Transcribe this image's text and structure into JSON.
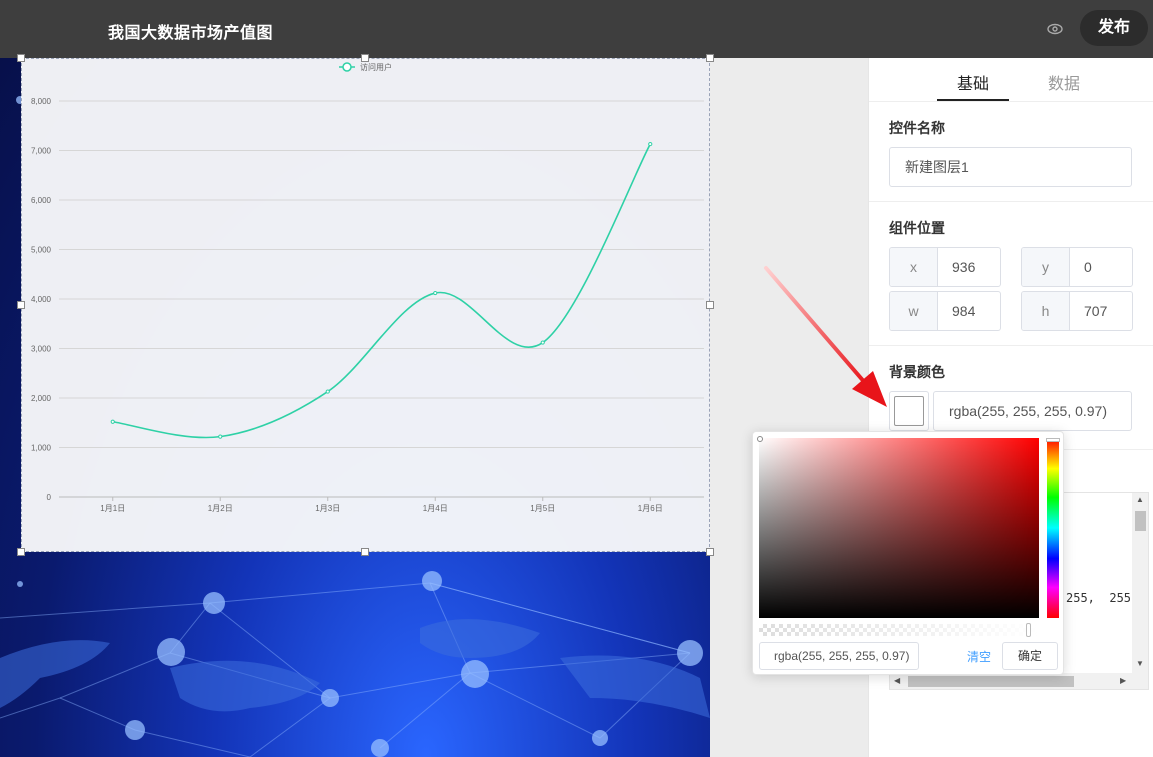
{
  "header": {
    "title": "我国大数据市场产值图",
    "publish_label": "发布"
  },
  "tabs": [
    {
      "label": "基础",
      "active": true
    },
    {
      "label": "数据",
      "active": false
    }
  ],
  "panel": {
    "name_section": {
      "title": "控件名称",
      "value": "新建图层1"
    },
    "position_section": {
      "title": "组件位置",
      "fields": [
        {
          "label": "x",
          "value": "936"
        },
        {
          "label": "y",
          "value": "0"
        },
        {
          "label": "w",
          "value": "984"
        },
        {
          "label": "h",
          "value": "707"
        }
      ]
    },
    "bg_section": {
      "title": "背景颜色",
      "value": "rgba(255, 255, 255, 0.97)"
    },
    "code_snippet": "255,  255,"
  },
  "color_picker": {
    "input_value": "rgba(255, 255, 255, 0.97)",
    "clear_label": "清空",
    "confirm_label": "确定",
    "alpha": 0.97
  },
  "chart_data": {
    "type": "line",
    "legend": [
      "访问用户"
    ],
    "legend_position": "top-center",
    "categories": [
      "1月1日",
      "1月2日",
      "1月3日",
      "1月4日",
      "1月5日",
      "1月6日"
    ],
    "series": [
      {
        "name": "访问用户",
        "values": [
          1520,
          1220,
          2130,
          4120,
          3120,
          7130
        ],
        "color": "#2ed1a6"
      }
    ],
    "ylim": [
      0,
      8000
    ],
    "yticks": [
      "0",
      "1,000",
      "2,000",
      "3,000",
      "4,000",
      "5,000",
      "6,000",
      "7,000",
      "8,000"
    ],
    "grid": true,
    "smooth": true
  },
  "colors": {
    "topbar": "#3e3e3e",
    "line": "#2ed1a6",
    "arrow": "#e8141a",
    "link": "#409eff"
  }
}
